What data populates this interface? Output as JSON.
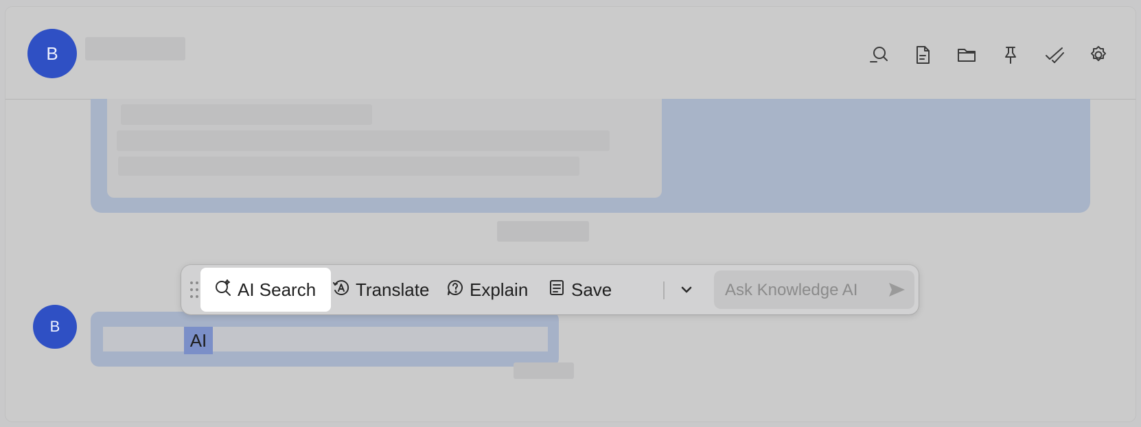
{
  "header": {
    "avatar_letter": "B",
    "icons": [
      "search-chat-icon",
      "document-icon",
      "folder-icon",
      "pin-icon",
      "done-check-icon",
      "settings-gear-icon"
    ]
  },
  "message": {
    "avatar_letter": "B",
    "selected_text": "AI"
  },
  "popup": {
    "ai_search_label": "AI Search",
    "translate_label": "Translate",
    "explain_label": "Explain",
    "save_label": "Save",
    "ask_placeholder": "Ask Knowledge AI"
  },
  "colors": {
    "avatar": "#2f50c4",
    "selection": "#7b8fc8",
    "active_button_bg": "#ffffff"
  }
}
